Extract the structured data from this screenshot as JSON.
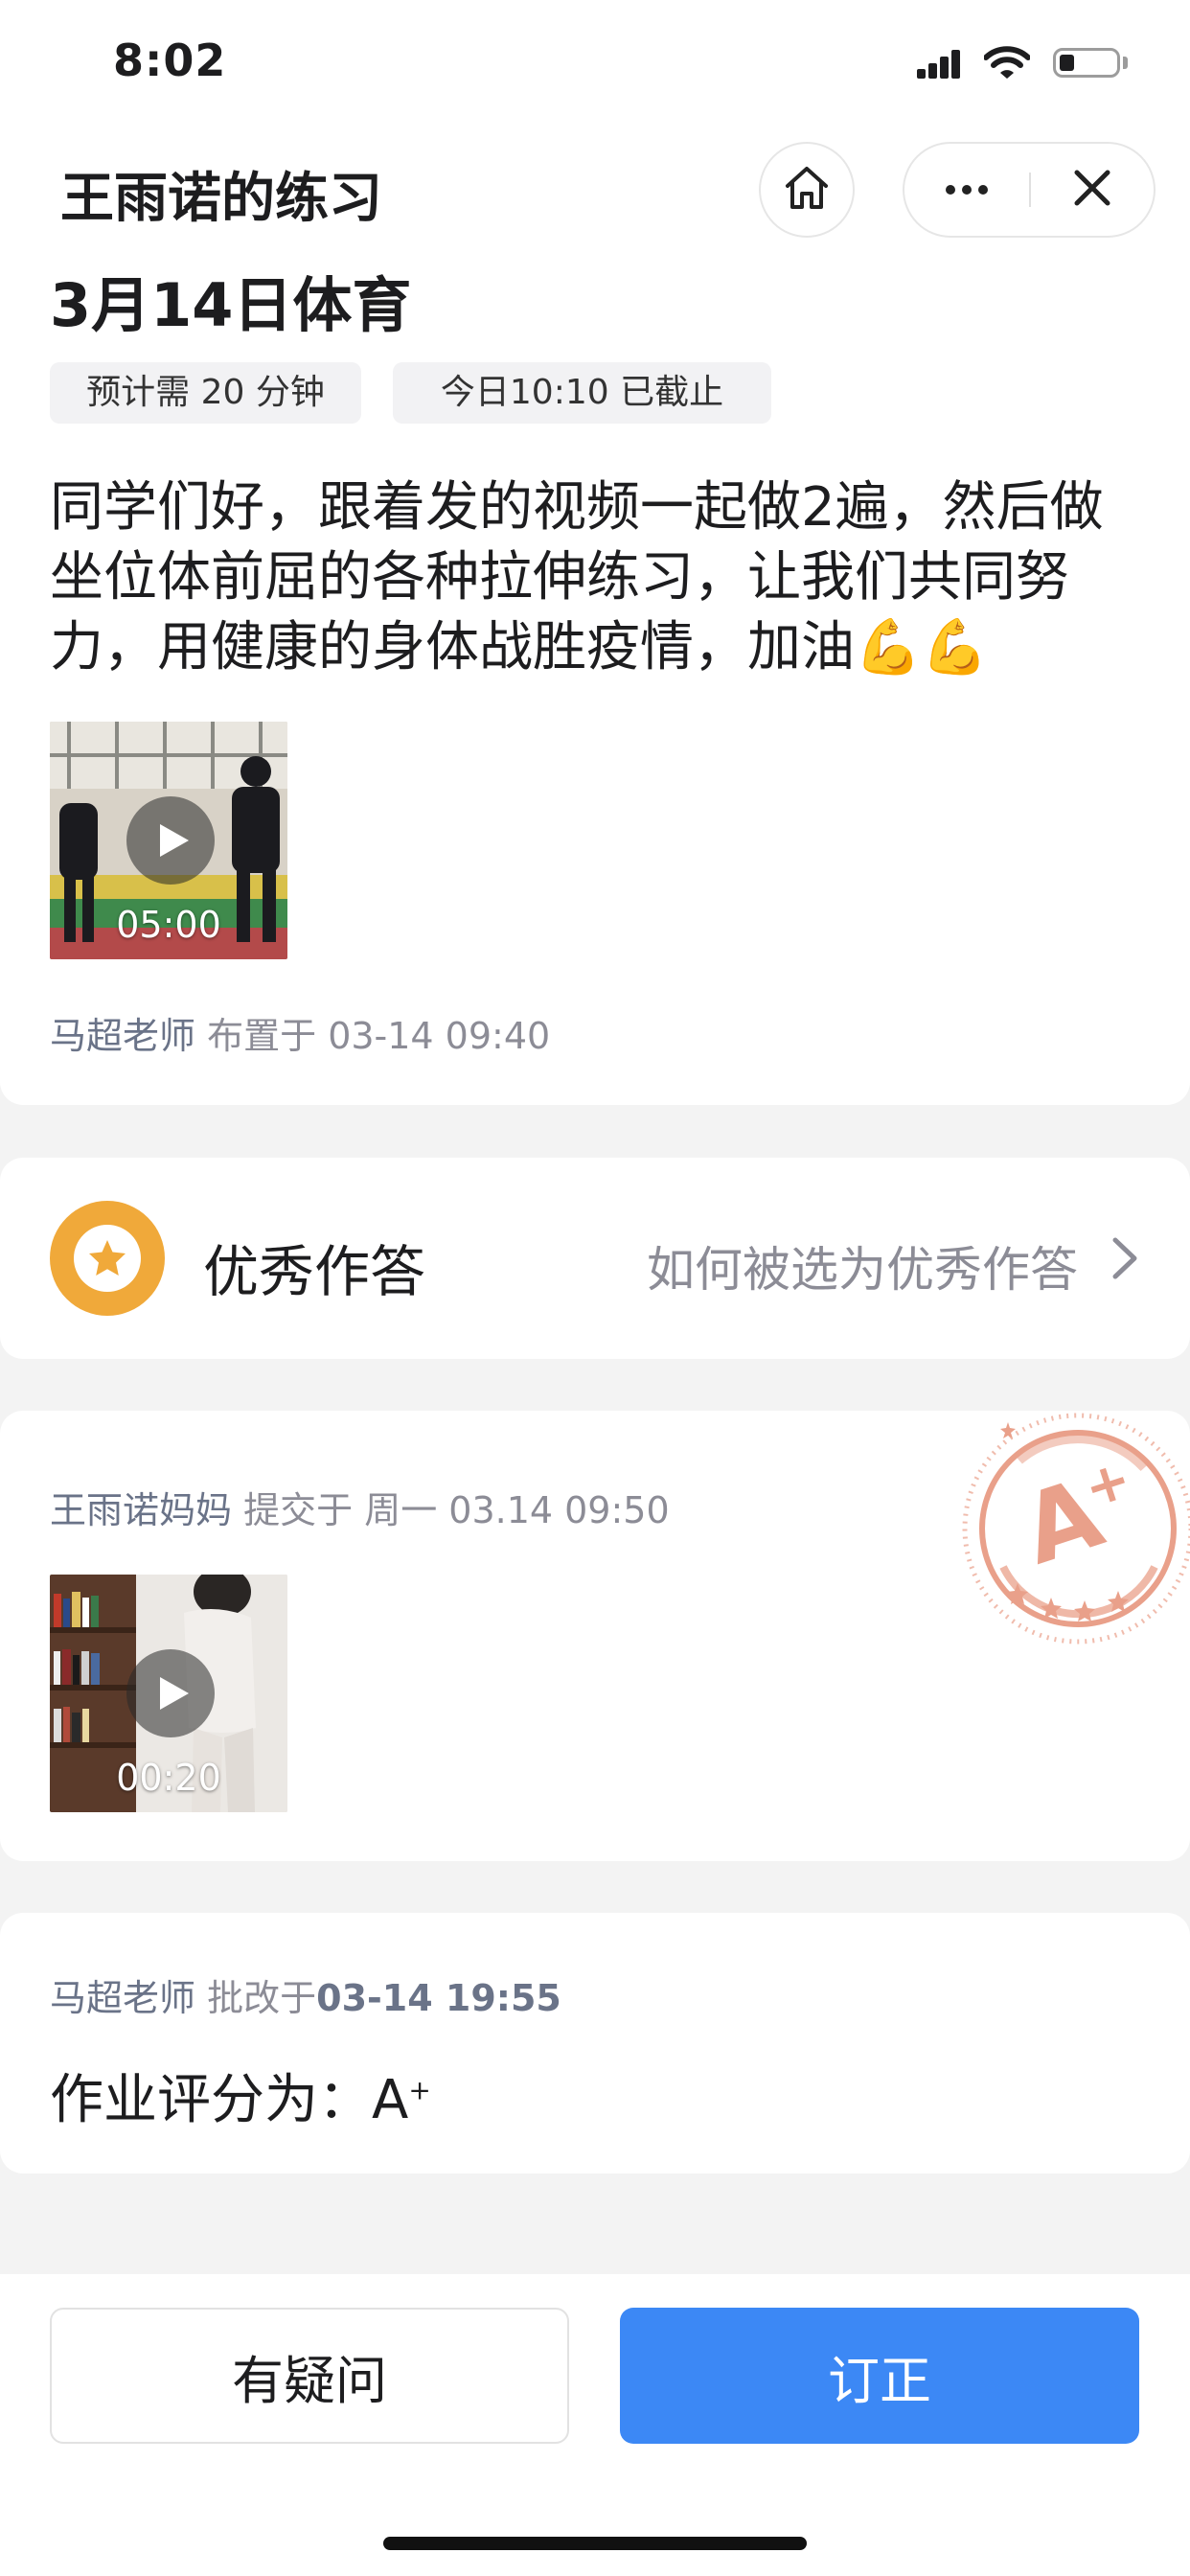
{
  "status_bar": {
    "time": "8:02"
  },
  "nav": {
    "title": "王雨诺的练习"
  },
  "homework": {
    "title": "3月14日体育",
    "duration_chip": "预计需 20 分钟",
    "deadline_chip": "今日10:10  已截止",
    "description": "同学们好，跟着发的视频一起做2遍，然后做坐位体前屈的各种拉伸练习，让我们共同努力，用健康的身体战胜疫情，加油",
    "description_emoji": "💪💪",
    "video": {
      "duration": "05:00"
    },
    "teacher": "马超老师",
    "assigned_at": "布置于 03-14 09:40"
  },
  "excellent": {
    "title": "优秀作答",
    "link_label": "如何被选为优秀作答"
  },
  "submission": {
    "submitter": "王雨诺妈妈",
    "submitted_at": "提交于  周一 03.14 09:50",
    "video": {
      "duration": "00:20"
    },
    "stamp_grade": "A",
    "stamp_plus": "+"
  },
  "grading": {
    "teacher": "马超老师",
    "label": "批改于",
    "time": "03-14 19:55",
    "result_label": "作业评分为：A",
    "result_plus": "+"
  },
  "actions": {
    "question_label": "有疑问",
    "correct_label": "订正"
  },
  "colors": {
    "accent": "#3c88f5",
    "medal": "#f0a93a",
    "stamp": "#e9a08a",
    "meta_text": "#8c8c96"
  }
}
